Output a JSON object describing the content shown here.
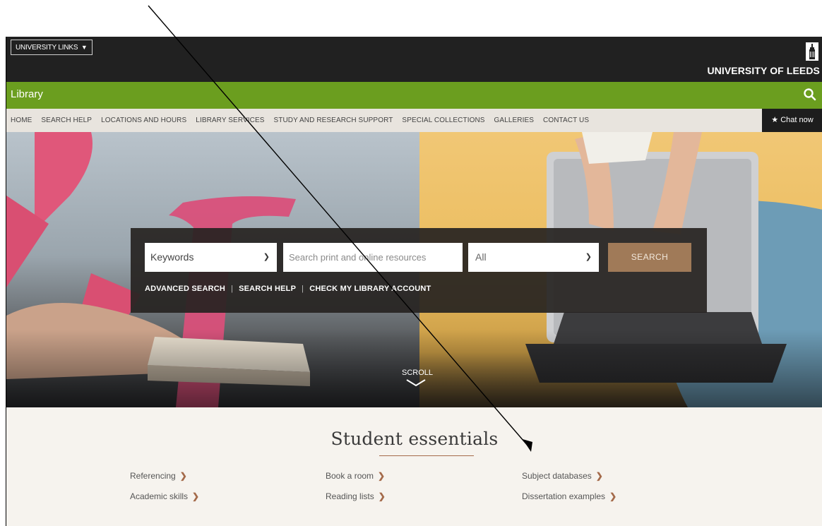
{
  "header": {
    "university_links": "UNIVERSITY LINKS",
    "university_name": "UNIVERSITY OF LEEDS"
  },
  "library_bar": {
    "title": "Library"
  },
  "nav": {
    "items": [
      "HOME",
      "SEARCH HELP",
      "LOCATIONS AND HOURS",
      "LIBRARY SERVICES",
      "STUDY AND RESEARCH SUPPORT",
      "SPECIAL COLLECTIONS",
      "GALLERIES",
      "CONTACT US"
    ],
    "chat_label": "Chat now"
  },
  "search": {
    "type_selected": "Keywords",
    "input_placeholder": "Search print and online resources",
    "scope_selected": "All",
    "button_label": "SEARCH",
    "links": [
      "ADVANCED SEARCH",
      "SEARCH HELP",
      "CHECK MY LIBRARY ACCOUNT"
    ]
  },
  "hero": {
    "scroll_label": "SCROLL"
  },
  "essentials": {
    "title": "Student essentials",
    "links": [
      "Referencing",
      "Academic skills",
      "Book a room",
      "Reading lists",
      "Subject databases",
      "Dissertation examples"
    ]
  },
  "colors": {
    "green_bar": "#6b9e1f",
    "top_bar": "#212121",
    "search_button": "#a07a58",
    "accent_arrow": "#a46a4a"
  }
}
